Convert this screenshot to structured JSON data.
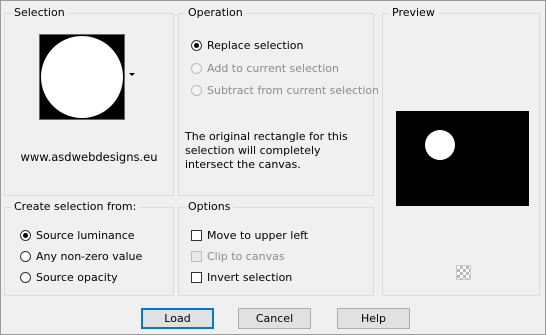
{
  "selection": {
    "title": "Selection",
    "watermark": "www.asdwebdesigns.eu"
  },
  "operation": {
    "title": "Operation",
    "options": [
      {
        "label": "Replace selection",
        "checked": true,
        "enabled": true
      },
      {
        "label": "Add to current selection",
        "checked": false,
        "enabled": false
      },
      {
        "label": "Subtract from current selection",
        "checked": false,
        "enabled": false
      }
    ],
    "description": "The original rectangle for this selection will completely intersect the canvas."
  },
  "preview": {
    "title": "Preview"
  },
  "create_from": {
    "title": "Create selection from:",
    "options": [
      {
        "label": "Source luminance",
        "checked": true
      },
      {
        "label": "Any non-zero value",
        "checked": false
      },
      {
        "label": "Source opacity",
        "checked": false
      }
    ]
  },
  "options": {
    "title": "Options",
    "items": [
      {
        "label": "Move to upper left",
        "checked": false,
        "enabled": true
      },
      {
        "label": "Clip to canvas",
        "checked": false,
        "enabled": false
      },
      {
        "label": "Invert selection",
        "checked": false,
        "enabled": true
      }
    ]
  },
  "buttons": {
    "load": "Load",
    "cancel": "Cancel",
    "help": "Help"
  }
}
